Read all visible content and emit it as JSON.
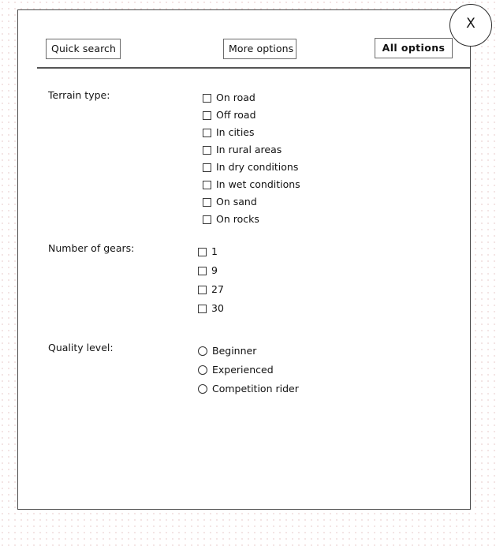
{
  "dialog": {
    "close_label": "X"
  },
  "tabs": [
    {
      "label": "Quick search",
      "active": false
    },
    {
      "label": "More options",
      "active": false
    },
    {
      "label": "All options",
      "active": true
    }
  ],
  "groups": [
    {
      "label": "Terrain type:",
      "control": "checkbox",
      "options": [
        {
          "label": "On road",
          "checked": false
        },
        {
          "label": "Off road",
          "checked": false
        },
        {
          "label": "In cities",
          "checked": false
        },
        {
          "label": "In rural areas",
          "checked": false
        },
        {
          "label": "In dry conditions",
          "checked": false
        },
        {
          "label": "In wet conditions",
          "checked": false
        },
        {
          "label": "On sand",
          "checked": false
        },
        {
          "label": "On rocks",
          "checked": false
        }
      ]
    },
    {
      "label": "Number of gears:",
      "control": "checkbox",
      "options": [
        {
          "label": "1",
          "checked": false
        },
        {
          "label": "9",
          "checked": false
        },
        {
          "label": "27",
          "checked": false
        },
        {
          "label": "30",
          "checked": false
        }
      ]
    },
    {
      "label": "Quality level:",
      "control": "radio",
      "options": [
        {
          "label": "Beginner",
          "checked": false
        },
        {
          "label": "Experienced",
          "checked": false
        },
        {
          "label": "Competition rider",
          "checked": false
        }
      ]
    }
  ]
}
